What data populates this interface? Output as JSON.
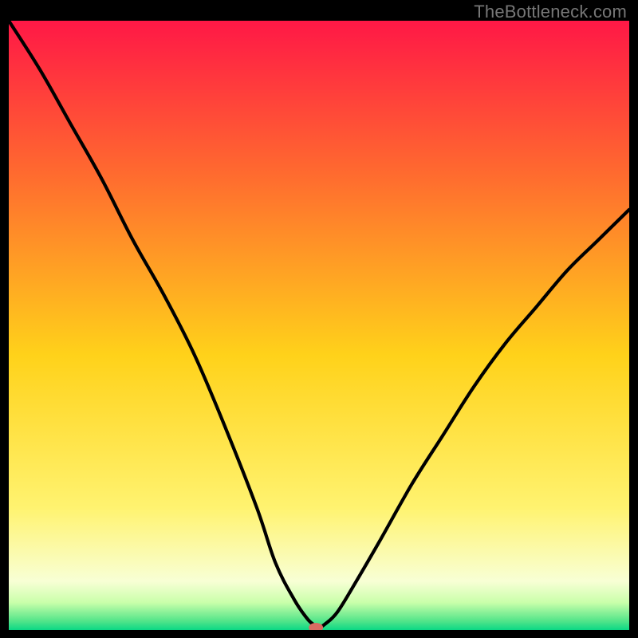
{
  "watermark": "TheBottleneck.com",
  "chart_data": {
    "type": "line",
    "title": "",
    "xlabel": "",
    "ylabel": "",
    "xlim": [
      0,
      100
    ],
    "ylim": [
      0,
      100
    ],
    "background_gradient": {
      "stops": [
        {
          "offset": 0.0,
          "color": "#ff1846"
        },
        {
          "offset": 0.25,
          "color": "#ff6a2f"
        },
        {
          "offset": 0.55,
          "color": "#ffd21a"
        },
        {
          "offset": 0.8,
          "color": "#fff370"
        },
        {
          "offset": 0.92,
          "color": "#f8ffd5"
        },
        {
          "offset": 0.955,
          "color": "#c9ffaa"
        },
        {
          "offset": 0.985,
          "color": "#54e58a"
        },
        {
          "offset": 1.0,
          "color": "#0bd885"
        }
      ]
    },
    "series": [
      {
        "name": "bottleneck-curve",
        "x": [
          0,
          5,
          10,
          15,
          20,
          25,
          30,
          35,
          40,
          43,
          46,
          48,
          49,
          50,
          51,
          53,
          56,
          60,
          65,
          70,
          75,
          80,
          85,
          90,
          95,
          100
        ],
        "y": [
          100,
          92,
          83,
          74,
          64,
          55,
          45,
          33,
          20,
          11,
          5,
          2,
          1,
          0.5,
          1,
          3,
          8,
          15,
          24,
          32,
          40,
          47,
          53,
          59,
          64,
          69
        ]
      }
    ],
    "marker": {
      "x": 49.5,
      "y": 0.4,
      "color": "#d96c62",
      "rx": 9,
      "ry": 6
    }
  }
}
